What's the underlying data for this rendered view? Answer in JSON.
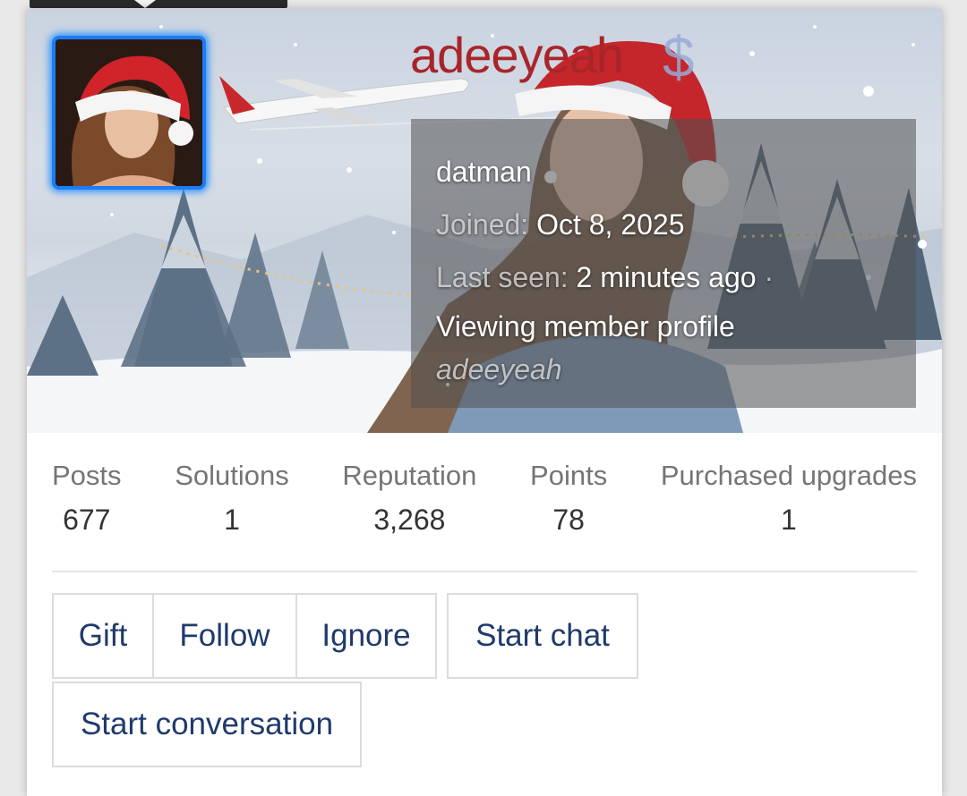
{
  "profile": {
    "banner_username": "adeeyeah",
    "upgrade_icon": "dollar-icon",
    "username": "datman",
    "joined_label": "Joined:",
    "joined_value": "Oct 8, 2025",
    "last_seen_label": "Last seen:",
    "last_seen_value": "2 minutes ago",
    "separator": "·",
    "activity": "Viewing member profile",
    "activity_user": "adeeyeah",
    "avatar_border_color": "#1c7cf5",
    "username_color": "#a8252a"
  },
  "stats": [
    {
      "label": "Posts",
      "value": "677"
    },
    {
      "label": "Solutions",
      "value": "1"
    },
    {
      "label": "Reputation",
      "value": "3,268"
    },
    {
      "label": "Points",
      "value": "78"
    },
    {
      "label": "Purchased upgrades",
      "value": "1"
    }
  ],
  "actions": {
    "gift": "Gift",
    "follow": "Follow",
    "ignore": "Ignore",
    "start_chat": "Start chat",
    "start_conversation": "Start conversation"
  },
  "colors": {
    "button_text": "#1f3a6b",
    "stat_label": "#757575",
    "stat_value": "#333333"
  }
}
